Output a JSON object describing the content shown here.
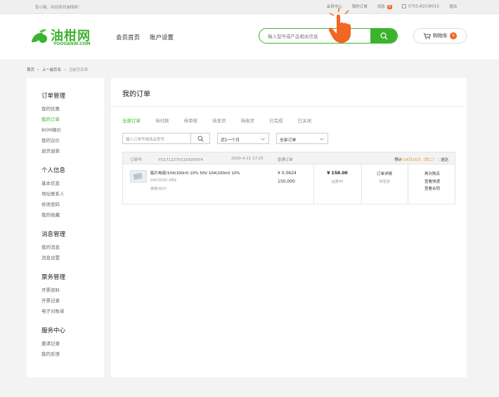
{
  "topbar": {
    "welcome": "张小猫，欢迎来到油柑网！",
    "member_center": "会员中心",
    "my_orders": "我的订单",
    "messages": "消息",
    "message_count": "6",
    "phone": "0755-82538015",
    "logout": "退出"
  },
  "logo": {
    "cn": "油柑网",
    "en": "YOUGANW.COM"
  },
  "nav": {
    "home": "会员首页",
    "settings": "账户设置"
  },
  "search": {
    "placeholder": "输入型号或产品相关信息"
  },
  "cart": {
    "label": "购物车",
    "count": "0"
  },
  "breadcrumb": {
    "home": "首页",
    "parent": "上一级页名",
    "current": "当前页名称"
  },
  "sidebar": {
    "groups": [
      {
        "title": "订单管理",
        "items": [
          "我的优惠",
          "我的订单",
          "BOM报价",
          "我的议价",
          "退货退款"
        ]
      },
      {
        "title": "个人信息",
        "items": [
          "基本信息",
          "地址联系人",
          "修改密码",
          "我的收藏"
        ]
      },
      {
        "title": "消息管理",
        "items": [
          "我的消息",
          "消息设置"
        ]
      },
      {
        "title": "票务管理",
        "items": [
          "开票资料",
          "开票记录",
          "电子对账单"
        ]
      },
      {
        "title": "服务中心",
        "items": [
          "邀请记录",
          "我的反馈"
        ]
      }
    ]
  },
  "main": {
    "title": "我的订单",
    "tabs": [
      "全部订单",
      "待付款",
      "待审核",
      "待发货",
      "待收货",
      "已完成",
      "已关闭"
    ],
    "filter_placeholder": "输入订单号或商品型号",
    "period": "近1一个月",
    "order_type": "全部订单"
  },
  "order": {
    "number_label": "订单号:",
    "number": "YG1712270115609974",
    "datetime": "2020-4-21 17:25",
    "type": "普通订单",
    "expected_label": "预计",
    "expected_date": "04月16日（周二）",
    "delivery": "送达",
    "product_name": "贴片电容/104(100nf) 10% 50V 104(100nf) 10%",
    "product_code": "0402005.MRL",
    "product_brand": "美隆(BLP)",
    "unit_price": "¥ 0.0624",
    "quantity": "150,000",
    "total": "¥ 158.00",
    "freight": "运费¥0",
    "detail_link": "订单详情",
    "status": "待发货",
    "actions": [
      "再次购买",
      "查看快递",
      "查看合同"
    ]
  },
  "colors": {
    "brand_green": "#3cb32d",
    "accent_orange": "#f26522"
  }
}
